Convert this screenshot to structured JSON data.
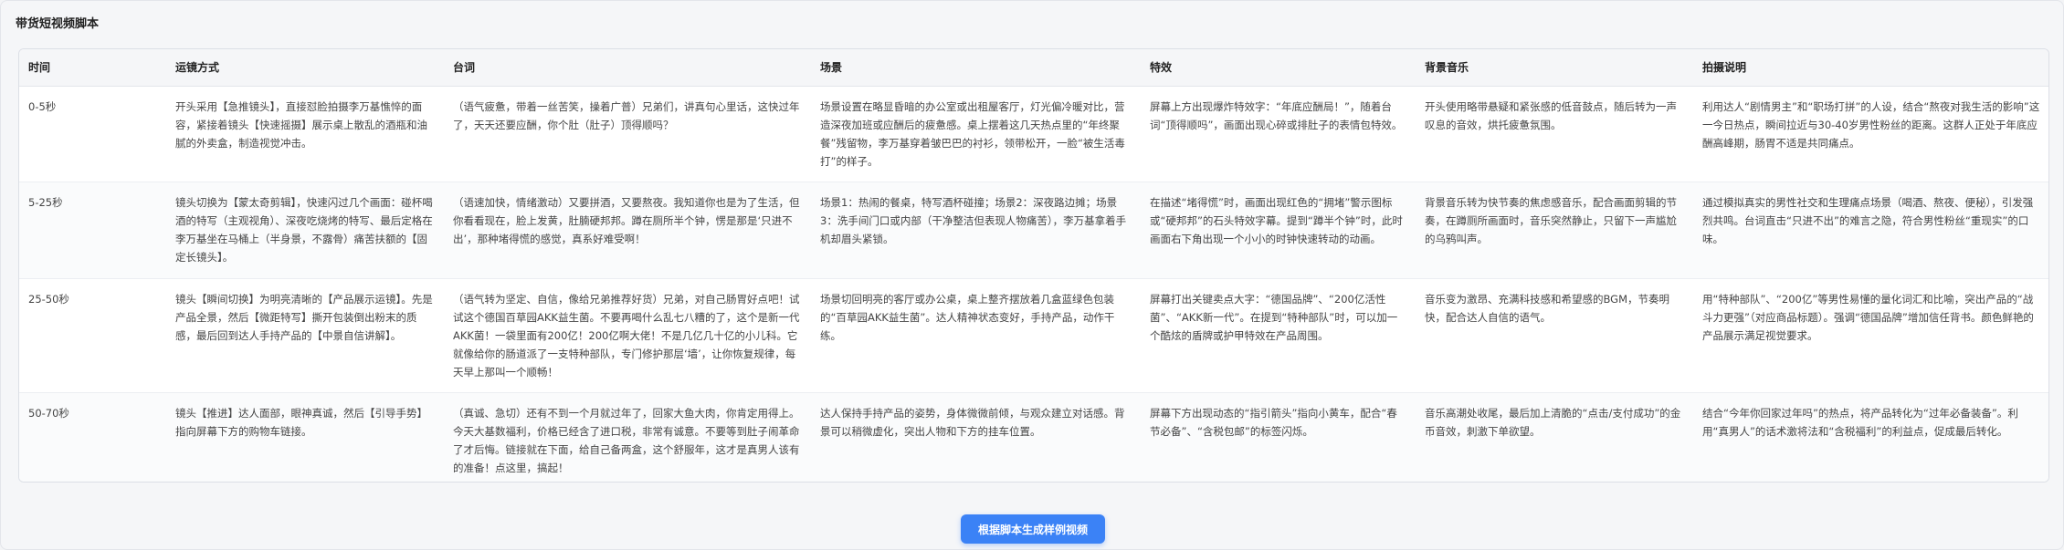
{
  "panel": {
    "title": "带货短视频脚本"
  },
  "table": {
    "headers": [
      "时间",
      "运镜方式",
      "台词",
      "场景",
      "特效",
      "背景音乐",
      "拍摄说明"
    ],
    "rows": [
      [
        "0-5秒",
        "开头采用【急推镜头】，直接怼脸拍摄李万基憔悴的面容，紧接着镜头【快速摇摄】展示桌上散乱的酒瓶和油腻的外卖盒，制造视觉冲击。",
        "（语气疲惫，带着一丝苦笑，操着广普）兄弟们，讲真句心里话，这快过年了，天天还要应酬，你个肚（肚子）顶得顺吗？",
        "场景设置在略显昏暗的办公室或出租屋客厅，灯光偏冷暖对比，营造深夜加班或应酬后的疲惫感。桌上摆着这几天热点里的“年终聚餐”残留物，李万基穿着皱巴巴的衬衫，领带松开，一脸“被生活毒打”的样子。",
        "屏幕上方出现爆炸特效字：“年底应酬局！”，随着台词“顶得顺吗”，画面出现心碎或排肚子的表情包特效。",
        "开头使用略带悬疑和紧张感的低音鼓点，随后转为一声叹息的音效，烘托疲惫氛围。",
        "利用达人“剧情男主”和“职场打拼”的人设，结合“熬夜对我生活的影响”这一今日热点，瞬间拉近与30-40岁男性粉丝的距离。这群人正处于年底应酬高峰期，肠胃不适是共同痛点。"
      ],
      [
        "5-25秒",
        "镜头切换为【蒙太奇剪辑】，快速闪过几个画面：碰杯喝酒的特写（主观视角）、深夜吃烧烤的特写、最后定格在李万基坐在马桶上（半身景，不露骨）痛苦扶额的【固定长镜头】。",
        "（语速加快，情绪激动）又要拼酒，又要熬夜。我知道你也是为了生活，但你看看现在，脸上发黄，肚腩硬邦邦。蹲在厕所半个钟，愣是那是‘只进不出’，那种堵得慌的感觉，真系好难受啊！",
        "场景1：热闹的餐桌，特写酒杯碰撞；场景2：深夜路边摊；场景3：洗手间门口或内部（干净整洁但表现人物痛苦），李万基拿着手机却眉头紧锁。",
        "在描述“堵得慌”时，画面出现红色的“拥堵”警示图标或“硬邦邦”的石头特效字幕。提到“蹲半个钟”时，此时画面右下角出现一个小小的时钟快速转动的动画。",
        "背景音乐转为快节奏的焦虑感音乐，配合画面剪辑的节奏，在蹲厕所画面时，音乐突然静止，只留下一声尴尬的乌鸦叫声。",
        "通过模拟真实的男性社交和生理痛点场景（喝酒、熬夜、便秘），引发强烈共鸣。台词直击“只进不出”的难言之隐，符合男性粉丝“重现实”的口味。"
      ],
      [
        "25-50秒",
        "镜头【瞬间切换】为明亮清晰的【产品展示运镜】。先是产品全景，然后【微距特写】撕开包装倒出粉末的质感，最后回到达人手持产品的【中景自信讲解】。",
        "（语气转为坚定、自信，像给兄弟推荐好货）兄弟，对自己肠胃好点吧！试试这个德国百草园AKK益生菌。不要再喝什么乱七八糟的了，这个是新一代AKK菌！一袋里面有200亿！200亿啊大佬！不是几亿几十亿的小儿科。它就像给你的肠道派了一支特种部队，专门修护那层‘墙’，让你恢复规律，每天早上那叫一个顺畅！",
        "场景切回明亮的客厅或办公桌，桌上整齐摆放着几盒蓝绿色包装的“百草园AKK益生菌”。达人精神状态变好，手持产品，动作干练。",
        "屏幕打出关键卖点大字：“德国品牌”、“200亿活性菌”、“AKK新一代”。在提到“特种部队”时，可以加一个酷炫的盾牌或护甲特效在产品周围。",
        "音乐变为激昂、充满科技感和希望感的BGM，节奏明快，配合达人自信的语气。",
        "用“特种部队”、“200亿”等男性易懂的量化词汇和比喻，突出产品的“战斗力更强”（对应商品标题）。强调“德国品牌”增加信任背书。颜色鲜艳的产品展示满足视觉要求。"
      ],
      [
        "50-70秒",
        "镜头【推进】达人面部，眼神真诚，然后【引导手势】指向屏幕下方的购物车链接。",
        "（真诚、急切）还有不到一个月就过年了，回家大鱼大肉，你肯定用得上。今天大基数福利，价格已经含了进口税，非常有诚意。不要等到肚子闹革命了才后悔。链接就在下面，给自己备两盒，这个舒服年，这才是真男人该有的准备！点这里，搞起！",
        "达人保持手持产品的姿势，身体微微前倾，与观众建立对话感。背景可以稍微虚化，突出人物和下方的挂车位置。",
        "屏幕下方出现动态的“指引箭头”指向小黄车，配合“春节必备”、“含税包邮”的标签闪烁。",
        "音乐高潮处收尾，最后加上清脆的“点击/支付成功”的金币音效，刺激下单欲望。",
        "结合“今年你回家过年吗”的热点，将产品转化为“过年必备装备”。利用“真男人”的话术激将法和“含税福利”的利益点，促成最后转化。"
      ]
    ]
  },
  "generate_button": {
    "label": "根据脚本生成样例视频"
  }
}
